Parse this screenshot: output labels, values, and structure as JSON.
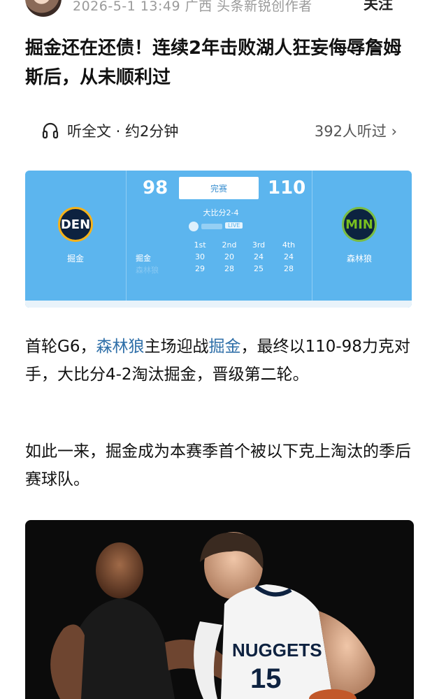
{
  "header": {
    "meta": "2026-5-1  13:49  广西  头条新锐创作者",
    "follow_label": "关注"
  },
  "article": {
    "title": "掘金还在还债！连续2年击败湖人狂妄侮辱詹姆斯后，从未顺利过"
  },
  "listen": {
    "icon": "headphones-icon",
    "label": "听全文 · 约2分钟",
    "count": "392人听过 ›"
  },
  "scoreboard": {
    "home_abbr": "DEN",
    "home_name": "掘金",
    "away_abbr": "MIN",
    "away_name": "森林狼",
    "home_score": "98",
    "away_score": "110",
    "status": "完赛",
    "series": "大比分2-4",
    "live_badge": "LIVE",
    "quarters": [
      "1st",
      "2nd",
      "3rd",
      "4th"
    ],
    "rows": [
      {
        "team": "掘金",
        "scores": [
          "30",
          "20",
          "24",
          "24"
        ]
      },
      {
        "team": "森林狼",
        "scores": [
          "29",
          "28",
          "25",
          "28"
        ]
      }
    ],
    "colors": {
      "card": "#5cb5ee",
      "den_gold": "#f5b21a",
      "min_green": "#78be20"
    }
  },
  "body": {
    "p1_a": "首轮G6，",
    "p1_link1": "森林狼",
    "p1_b": "主场迎战",
    "p1_link2": "掘金",
    "p1_c": "，最终以110-98力克对手，大比分4-2淘汰掘金，晋级第二轮。",
    "p2": "如此一来，掘金成为本赛季首个被以下克上淘汰的季后赛球队。"
  },
  "photo": {
    "jersey_text": "NUGGETS",
    "jersey_number": "15"
  }
}
